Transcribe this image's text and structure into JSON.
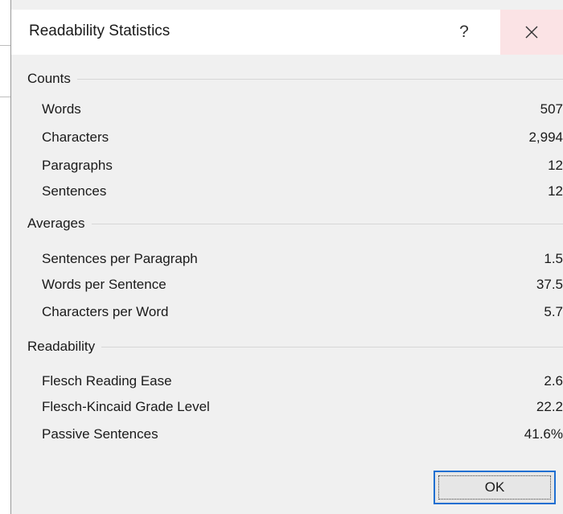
{
  "dialog": {
    "title": "Readability Statistics",
    "help_label": "?",
    "close_icon": "close-icon",
    "ok_label": "OK"
  },
  "counts": {
    "header": "Counts",
    "rows": [
      {
        "label": "Words",
        "value": "507"
      },
      {
        "label": "Characters",
        "value": "2,994"
      },
      {
        "label": "Paragraphs",
        "value": "12"
      },
      {
        "label": "Sentences",
        "value": "12"
      }
    ]
  },
  "averages": {
    "header": "Averages",
    "rows": [
      {
        "label": "Sentences per Paragraph",
        "value": "1.5"
      },
      {
        "label": "Words per Sentence",
        "value": "37.5"
      },
      {
        "label": "Characters per Word",
        "value": "5.7"
      }
    ]
  },
  "readability": {
    "header": "Readability",
    "rows": [
      {
        "label": "Flesch Reading Ease",
        "value": "2.6"
      },
      {
        "label": "Flesch-Kincaid Grade Level",
        "value": "22.2"
      },
      {
        "label": "Passive Sentences",
        "value": "41.6%"
      }
    ]
  },
  "colors": {
    "close_hover_bg": "#fbe3e5",
    "ok_focus_border": "#1f6fd1",
    "dialog_bg": "#f0f0f0"
  }
}
